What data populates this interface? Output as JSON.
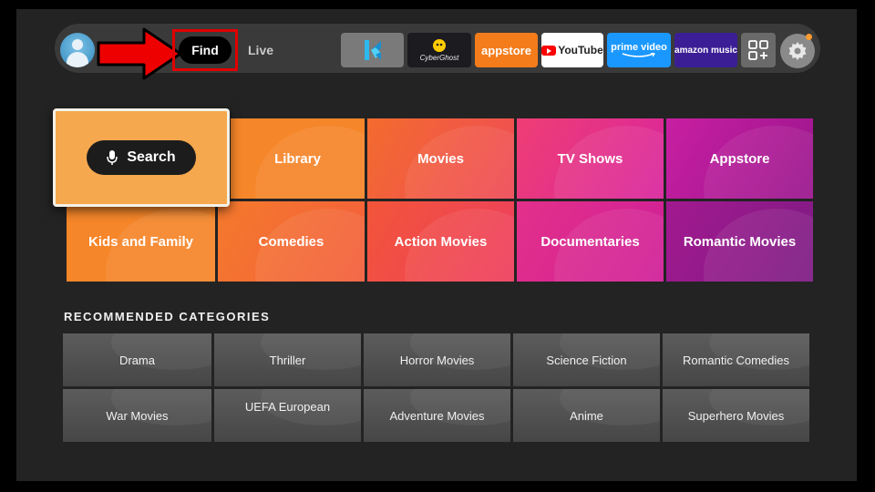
{
  "topbar": {
    "find_label": "Find",
    "live_label": "Live",
    "apps": {
      "kodi": "kodi",
      "cyberghost": "CyberGhost",
      "appstore": "appstore",
      "youtube": "YouTube",
      "prime_video": "prime video",
      "amazon_music": "amazon music"
    }
  },
  "tiles": {
    "search": "Search",
    "library": "Library",
    "movies": "Movies",
    "tv_shows": "TV Shows",
    "appstore": "Appstore",
    "kids_and_family": "Kids and Family",
    "comedies": "Comedies",
    "action_movies": "Action Movies",
    "documentaries": "Documentaries",
    "romantic_movies": "Romantic Movies"
  },
  "recommended": {
    "heading": "RECOMMENDED CATEGORIES",
    "items": [
      "Drama",
      "Thriller",
      "Horror Movies",
      "Science Fiction",
      "Romantic Comedies",
      "War Movies",
      "UEFA European",
      "Adventure Movies",
      "Anime",
      "Superhero Movies"
    ]
  },
  "colors": {
    "highlight_box": "#e10000",
    "accent_orange": "#f6862a",
    "notification_dot": "#ff9a2e"
  }
}
